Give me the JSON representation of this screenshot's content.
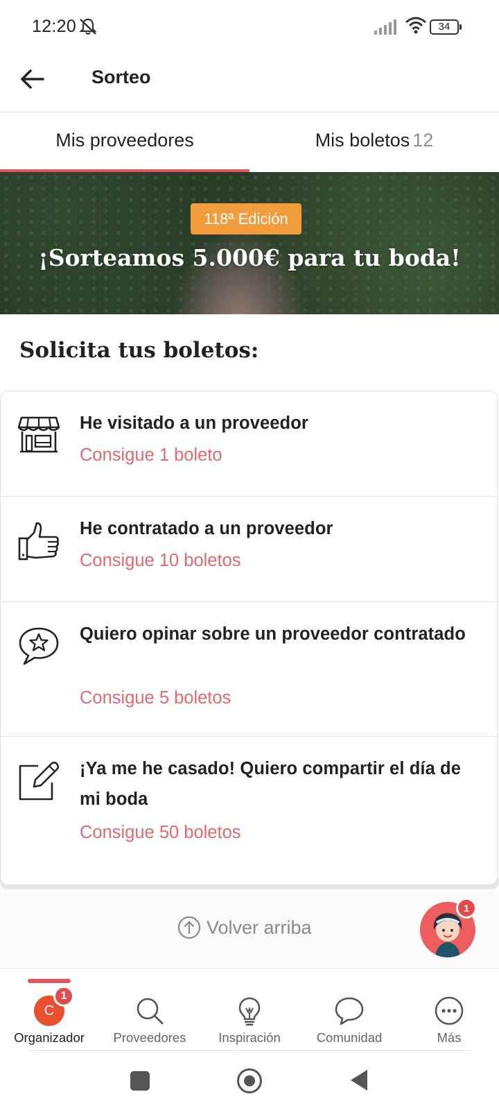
{
  "status_bar": {
    "time": "12:20",
    "battery": "34",
    "icons": [
      "mute-icon",
      "signal-icon",
      "wifi-icon",
      "battery-icon"
    ]
  },
  "app_bar": {
    "title": "Sorteo",
    "back_icon": "back-arrow-icon"
  },
  "tabs": [
    {
      "label": "Mis proveedores",
      "count": "",
      "active": true
    },
    {
      "label": "Mis boletos",
      "count": "12",
      "active": false
    }
  ],
  "banner": {
    "badge": "118ª Edición",
    "headline": "¡Sorteamos 5.000€ para tu boda!"
  },
  "section": {
    "heading": "Solicita tus boletos:"
  },
  "items": [
    {
      "icon": "store-icon",
      "title": "He visitado a un proveedor",
      "link": "Consigue 1 boleto"
    },
    {
      "icon": "thumbs-up-icon",
      "title": "He contratado a un proveedor",
      "link": "Consigue 10 boletos"
    },
    {
      "icon": "review-star-icon",
      "title": "Quiero opinar sobre un proveedor contratado",
      "link": "Consigue 5 boletos"
    },
    {
      "icon": "edit-icon",
      "title": "¡Ya me he casado! Quiero compartir el día de mi boda",
      "link": "Consigue 50 boletos"
    }
  ],
  "back_to_top": {
    "label": "Volver arriba",
    "icon": "arrow-up-circle-icon"
  },
  "assistant": {
    "badge": "1"
  },
  "bottom_nav": [
    {
      "label": "Organizador",
      "icon": "organizer-avatar-icon",
      "avatar_letter": "C",
      "badge": "1",
      "active": true
    },
    {
      "label": "Proveedores",
      "icon": "search-icon",
      "active": false
    },
    {
      "label": "Inspiración",
      "icon": "lightbulb-icon",
      "active": false
    },
    {
      "label": "Comunidad",
      "icon": "chat-bubble-icon",
      "active": false
    },
    {
      "label": "Más",
      "icon": "more-icon",
      "active": false
    }
  ],
  "colors": {
    "accent": "#e5555f",
    "link": "#e06a70",
    "badge_orange": "#f39c3c"
  }
}
